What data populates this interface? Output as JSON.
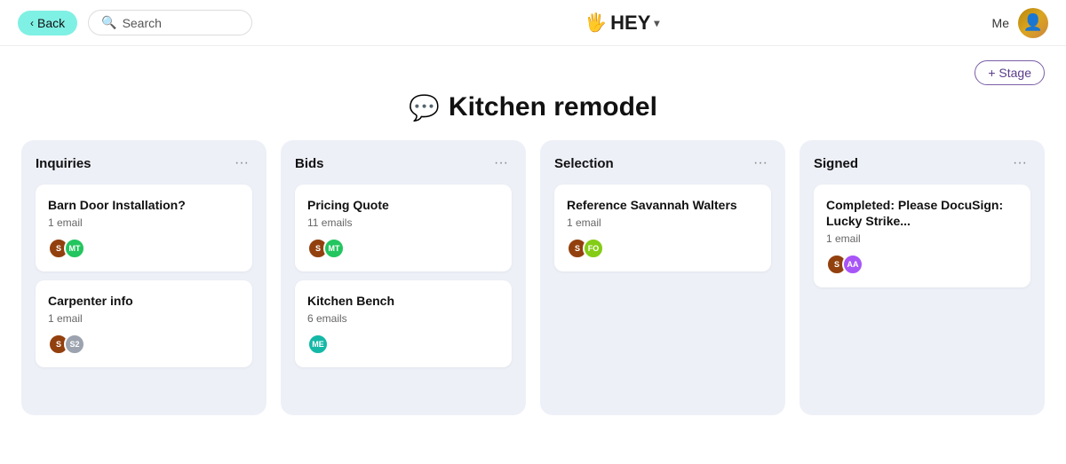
{
  "header": {
    "back_label": "Back",
    "search_placeholder": "Search",
    "logo_text": "HEY",
    "me_label": "Me"
  },
  "stage_button": {
    "label": "+ Stage"
  },
  "page": {
    "title": "Kitchen remodel",
    "title_icon": "💬"
  },
  "columns": [
    {
      "id": "inquiries",
      "title": "Inquiries",
      "cards": [
        {
          "title": "Barn Door Installation?",
          "count": "1 email",
          "avatars": [
            {
              "initials": "S",
              "color": "av-brown"
            },
            {
              "initials": "MT",
              "color": "av-green"
            }
          ]
        },
        {
          "title": "Carpenter info",
          "count": "1 email",
          "avatars": [
            {
              "initials": "S",
              "color": "av-brown"
            },
            {
              "initials": "S2",
              "color": "av-gray"
            }
          ]
        }
      ]
    },
    {
      "id": "bids",
      "title": "Bids",
      "cards": [
        {
          "title": "Pricing Quote",
          "count": "11 emails",
          "avatars": [
            {
              "initials": "S",
              "color": "av-brown"
            },
            {
              "initials": "MT",
              "color": "av-green"
            }
          ]
        },
        {
          "title": "Kitchen Bench",
          "count": "6 emails",
          "avatars": [
            {
              "initials": "ME",
              "color": "av-teal"
            }
          ]
        }
      ]
    },
    {
      "id": "selection",
      "title": "Selection",
      "cards": [
        {
          "title": "Reference Savannah Walters",
          "count": "1 email",
          "avatars": [
            {
              "initials": "S",
              "color": "av-brown"
            },
            {
              "initials": "FO",
              "color": "av-lime"
            }
          ]
        }
      ]
    },
    {
      "id": "signed",
      "title": "Signed",
      "cards": [
        {
          "title": "Completed: Please DocuSign: Lucky Strike...",
          "count": "1 email",
          "avatars": [
            {
              "initials": "S",
              "color": "av-brown"
            },
            {
              "initials": "AA",
              "color": "av-purple"
            }
          ]
        }
      ]
    }
  ]
}
